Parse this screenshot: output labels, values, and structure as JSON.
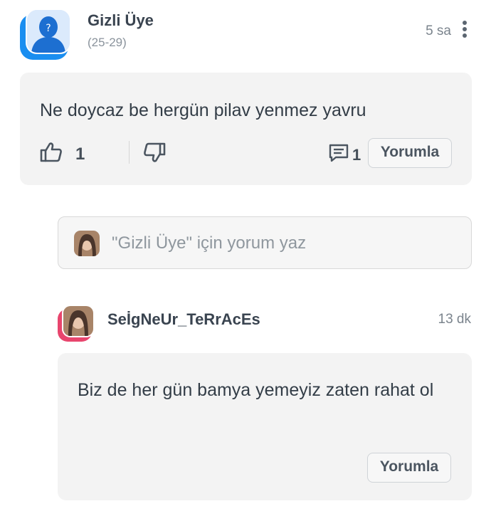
{
  "post": {
    "author": "Gizli Üye",
    "age_range": "(25-29)",
    "time": "5 sa",
    "text": "Ne doycaz be hergün pilav yenmez yavru",
    "like_count": "1",
    "reply_count": "1",
    "reply_button": "Yorumla",
    "avatar_icon": "anonymous-user-icon",
    "accent_color": "#1a8ef0"
  },
  "reply_input": {
    "placeholder": "\"Gizli Üye\" için yorum yaz"
  },
  "reply": {
    "author": "SeİgNeUr_TeRrAcEs",
    "time": "13 dk",
    "text": "Biz de her gün bamya yemeyiz zaten rahat ol",
    "reply_button": "Yorumla",
    "accent_color": "#e8456d"
  },
  "icons": {
    "like": "thumbs-up-icon",
    "dislike": "thumbs-down-icon",
    "comment": "comment-icon",
    "more": "more-vertical-icon"
  }
}
